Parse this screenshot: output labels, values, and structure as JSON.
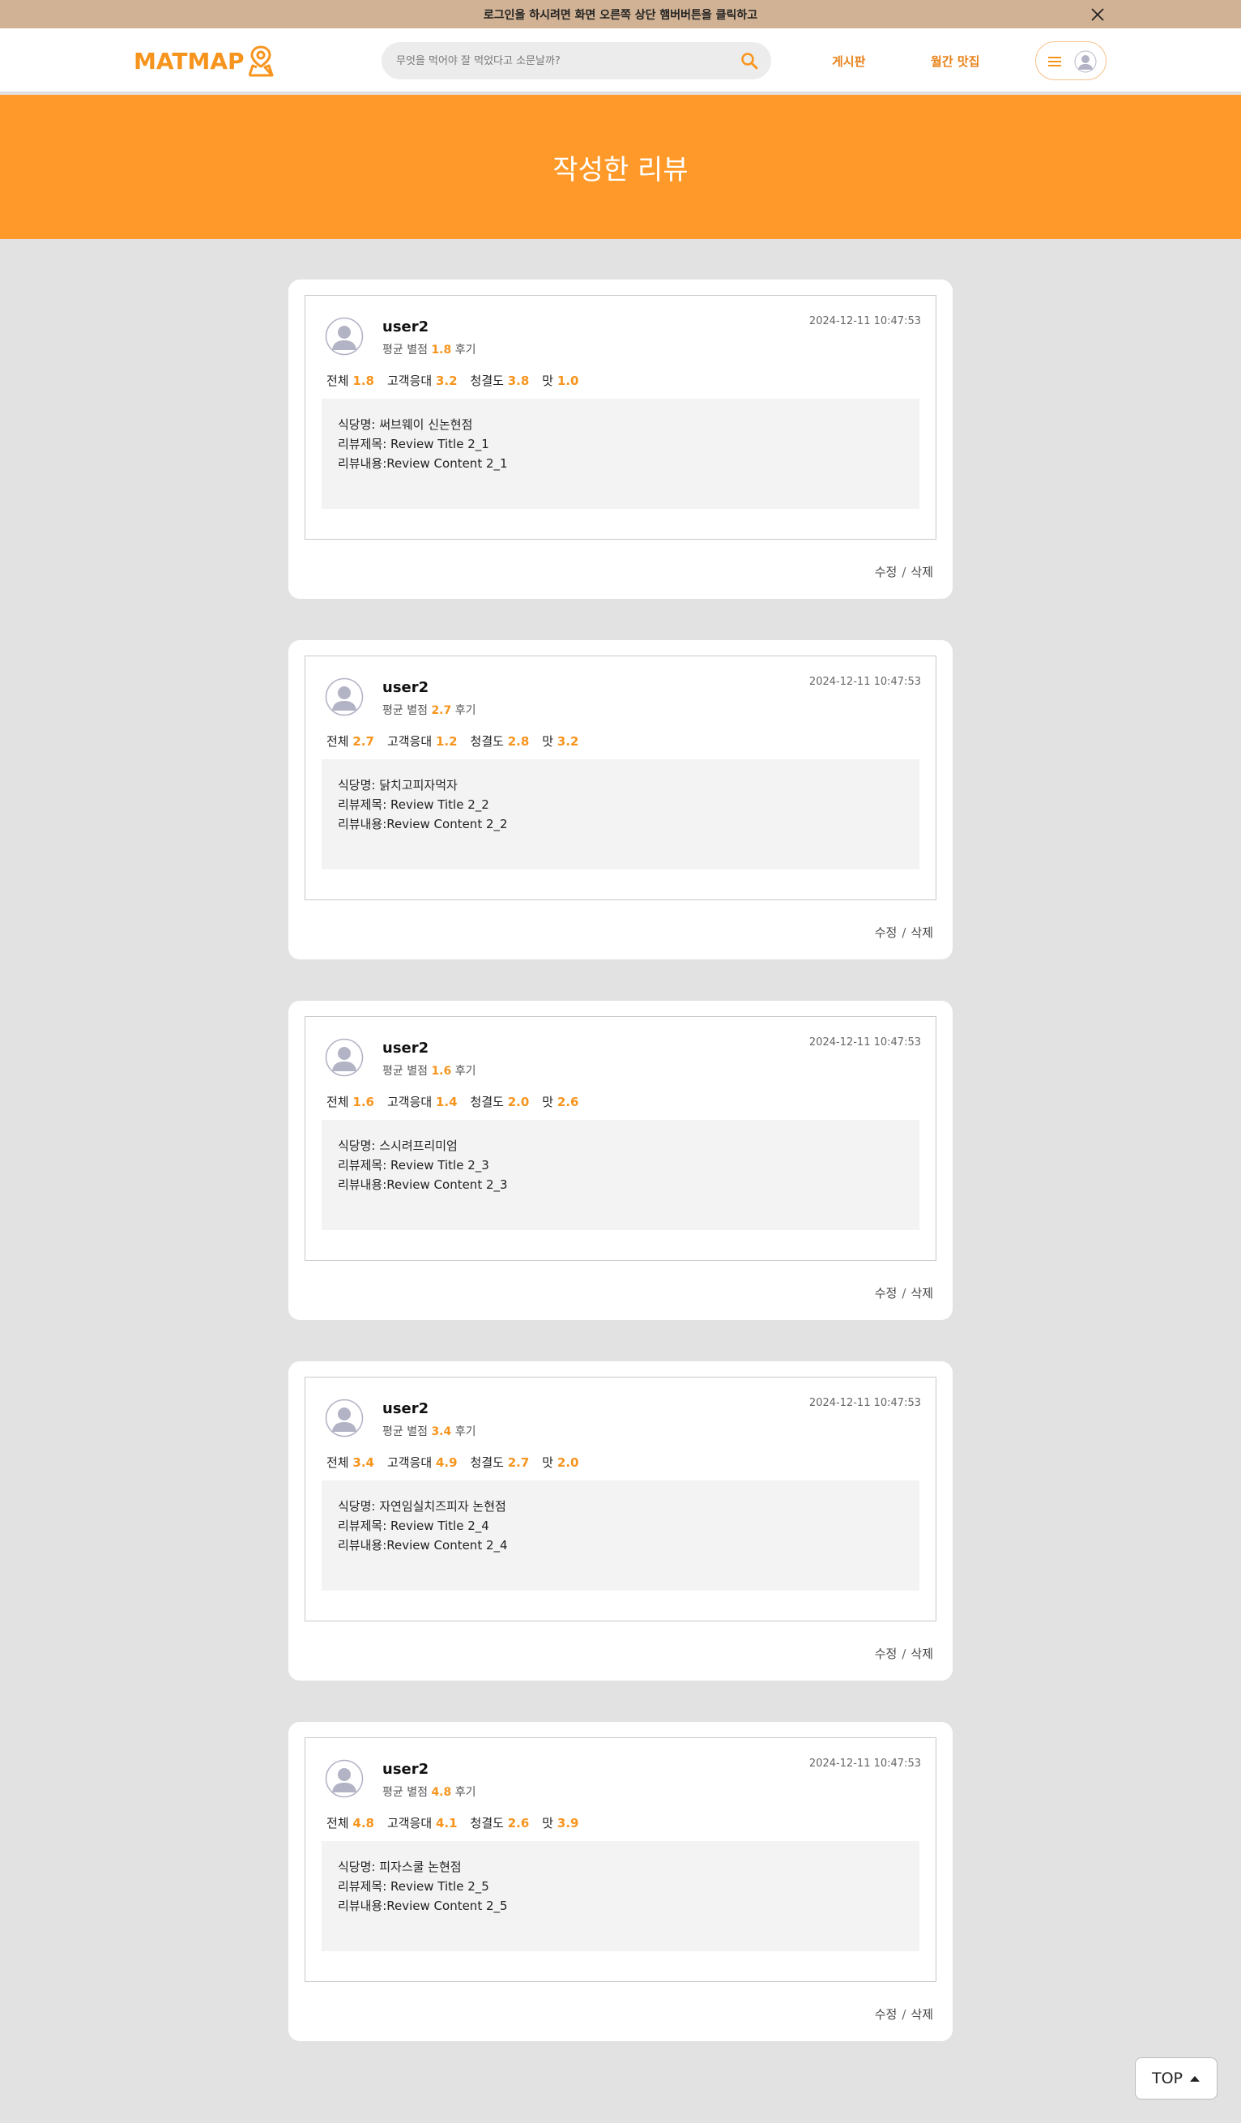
{
  "banner": {
    "text": "로그인을 하시려면 화면 오른쪽 상단 햄버버튼을 클릭하고",
    "close_icon": "close-icon"
  },
  "header": {
    "logo": "MATMAP",
    "logo_icon": "map-pin-icon",
    "search": {
      "placeholder": "무엇을 먹어야 잘 먹었다고 소문날까?",
      "value": ""
    },
    "nav": [
      {
        "label": "게시판"
      },
      {
        "label": "월간 맛집"
      }
    ],
    "menu_icon": "hamburger-icon",
    "user_icon": "user-avatar-icon"
  },
  "hero": {
    "title": "작성한 리뷰"
  },
  "reviews": [
    {
      "username": "user2",
      "avg_prefix": "평균 별점",
      "avg": "1.8",
      "avg_suffix": "후기",
      "date": "2024-12-11 10:47:53",
      "scores": {
        "total": "1.8",
        "service": "3.2",
        "clean": "3.8",
        "taste": "1.0"
      },
      "restaurant": "식당명: 써브웨이 신논현점",
      "title": "리뷰제목: Review Title 2_1",
      "content": "리뷰내용:Review Content 2_1"
    },
    {
      "username": "user2",
      "avg_prefix": "평균 별점",
      "avg": "2.7",
      "avg_suffix": "후기",
      "date": "2024-12-11 10:47:53",
      "scores": {
        "total": "2.7",
        "service": "1.2",
        "clean": "2.8",
        "taste": "3.2"
      },
      "restaurant": "식당명: 닭치고피자먹자",
      "title": "리뷰제목: Review Title 2_2",
      "content": "리뷰내용:Review Content 2_2"
    },
    {
      "username": "user2",
      "avg_prefix": "평균 별점",
      "avg": "1.6",
      "avg_suffix": "후기",
      "date": "2024-12-11 10:47:53",
      "scores": {
        "total": "1.6",
        "service": "1.4",
        "clean": "2.0",
        "taste": "2.6"
      },
      "restaurant": "식당명: 스시려프리미엄",
      "title": "리뷰제목: Review Title 2_3",
      "content": "리뷰내용:Review Content 2_3"
    },
    {
      "username": "user2",
      "avg_prefix": "평균 별점",
      "avg": "3.4",
      "avg_suffix": "후기",
      "date": "2024-12-11 10:47:53",
      "scores": {
        "total": "3.4",
        "service": "4.9",
        "clean": "2.7",
        "taste": "2.0"
      },
      "restaurant": "식당명: 자연임실치즈피자 논현점",
      "title": "리뷰제목: Review Title 2_4",
      "content": "리뷰내용:Review Content 2_4"
    },
    {
      "username": "user2",
      "avg_prefix": "평균 별점",
      "avg": "4.8",
      "avg_suffix": "후기",
      "date": "2024-12-11 10:47:53",
      "scores": {
        "total": "4.8",
        "service": "4.1",
        "clean": "2.6",
        "taste": "3.9"
      },
      "restaurant": "식당명: 피자스쿨 논현점",
      "title": "리뷰제목: Review Title 2_5",
      "content": "리뷰내용:Review Content 2_5"
    }
  ],
  "labels": {
    "total": "전체",
    "service": "고객응대",
    "clean": "청결도",
    "taste": "맛",
    "edit": "수정",
    "slash": "/",
    "delete": "삭제"
  },
  "top_button": {
    "label": "TOP",
    "icon": "caret-up-icon"
  },
  "colors": {
    "accent": "#f7941d",
    "hero": "#ff9a2a",
    "banner": "#d1b294",
    "background": "#e2e2e2"
  }
}
